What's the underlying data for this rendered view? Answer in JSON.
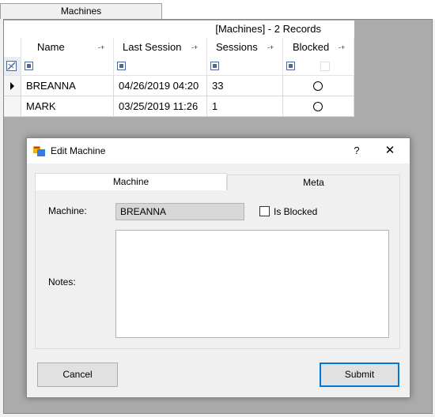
{
  "tabs": {
    "machines_label": "Machines"
  },
  "grid": {
    "caption": "[Machines] - 2 Records",
    "columns": [
      "Name",
      "Last Session",
      "Sessions",
      "Blocked"
    ],
    "filter_glyph": "-+",
    "rows": [
      {
        "name": "BREANNA",
        "last_session": "04/26/2019 04:20",
        "sessions": "33",
        "blocked": false
      },
      {
        "name": "MARK",
        "last_session": "03/25/2019 11:26",
        "sessions": "1",
        "blocked": false
      }
    ]
  },
  "dialog": {
    "title": "Edit Machine",
    "help_glyph": "?",
    "close_glyph": "✕",
    "tabs": [
      "Machine",
      "Meta"
    ],
    "machine_label": "Machine:",
    "machine_value": "BREANNA",
    "is_blocked_label": "Is Blocked",
    "is_blocked_checked": false,
    "notes_label": "Notes:",
    "notes_value": "",
    "cancel_label": "Cancel",
    "submit_label": "Submit"
  },
  "colors": {
    "accent": "#0078d7",
    "grid_bg": "#ababab",
    "window_bg": "#f0f0f0"
  }
}
